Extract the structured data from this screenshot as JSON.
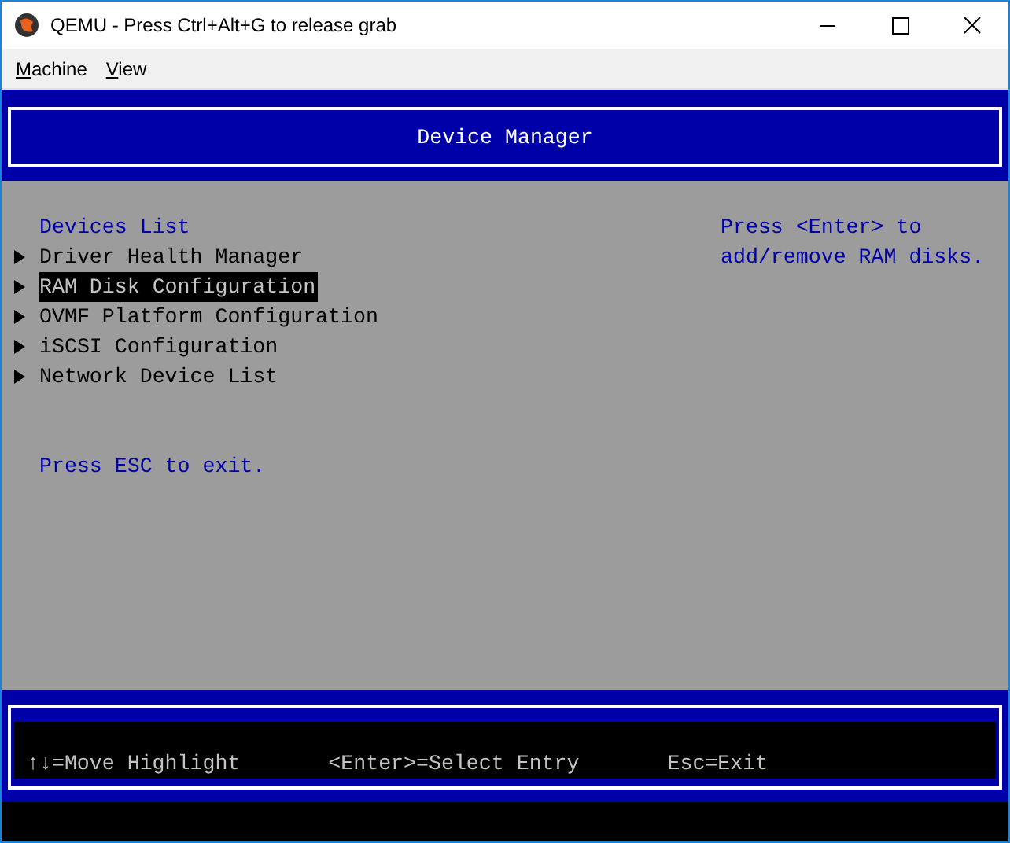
{
  "window": {
    "title": "QEMU - Press Ctrl+Alt+G to release grab"
  },
  "menu": [
    "Machine",
    "View"
  ],
  "header": {
    "title": "Device Manager"
  },
  "section_title": "Devices List",
  "items": [
    {
      "label": "Driver Health Manager",
      "selected": false
    },
    {
      "label": "RAM Disk Configuration",
      "selected": true
    },
    {
      "label": "OVMF Platform Configuration",
      "selected": false
    },
    {
      "label": "iSCSI Configuration",
      "selected": false
    },
    {
      "label": "Network Device List",
      "selected": false
    }
  ],
  "exit_hint": "Press ESC to exit.",
  "help": "Press <Enter> to\nadd/remove RAM disks.",
  "footer": [
    "↑↓=Move Highlight",
    "<Enter>=Select Entry",
    "Esc=Exit"
  ]
}
